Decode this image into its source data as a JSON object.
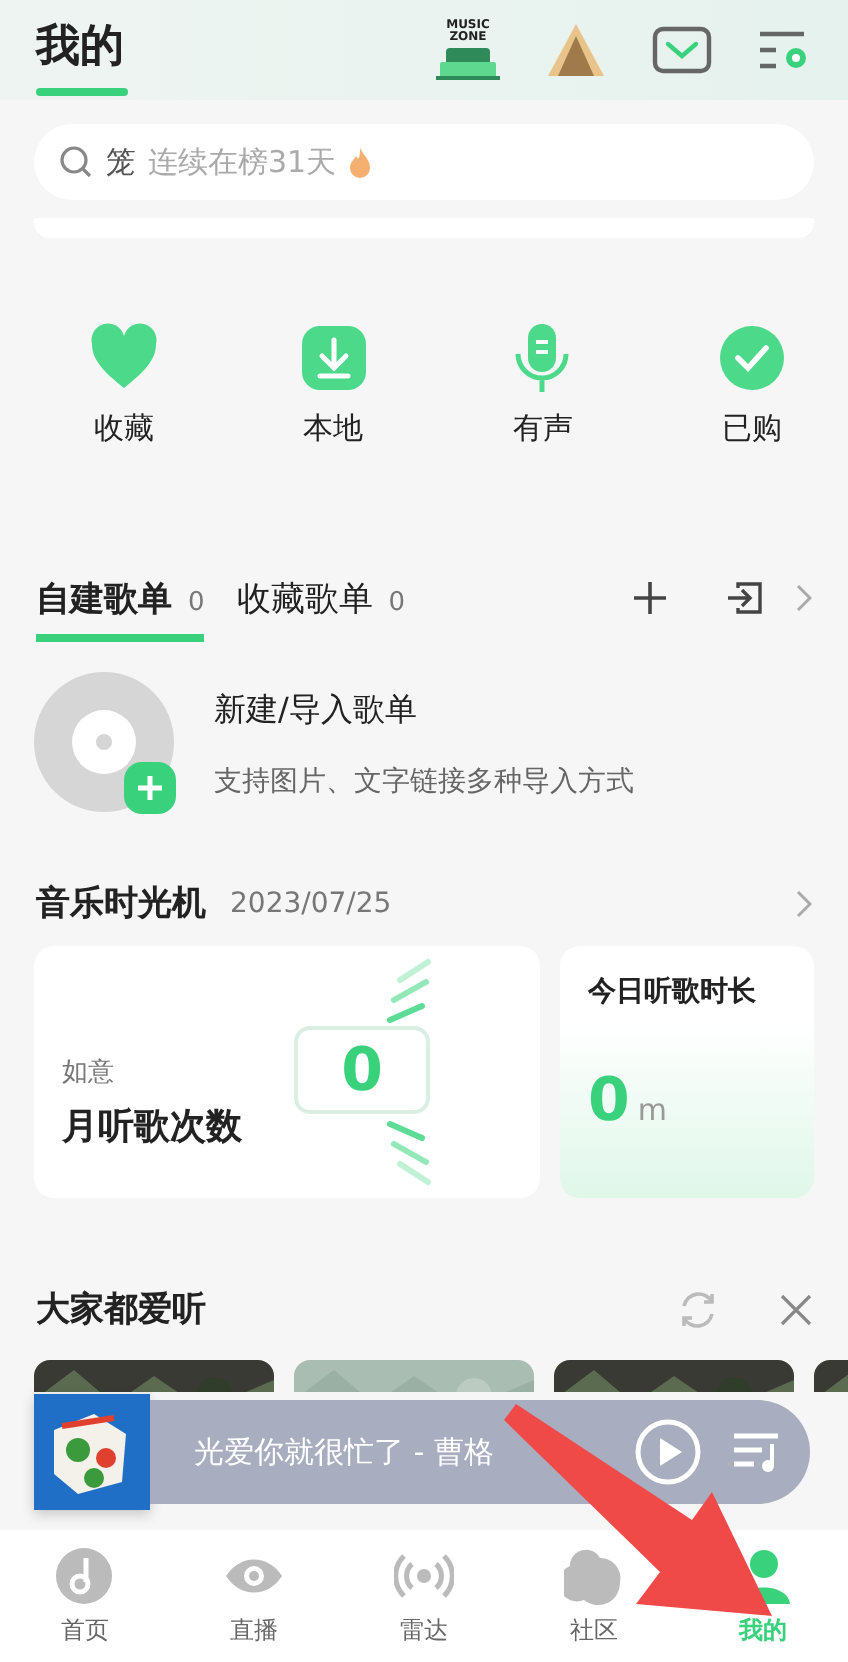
{
  "header": {
    "title": "我的",
    "zone_badge": [
      "MUSIC",
      "ZONE"
    ]
  },
  "search": {
    "prefix": "笼",
    "placeholder": "连续在榜31天"
  },
  "quick_actions": [
    {
      "kind": "heart",
      "label": "收藏"
    },
    {
      "kind": "download",
      "label": "本地"
    },
    {
      "kind": "mic",
      "label": "有声"
    },
    {
      "kind": "check",
      "label": "已购"
    }
  ],
  "playlist_tabs": [
    {
      "label": "自建歌单",
      "count": "0",
      "selected": true
    },
    {
      "label": "收藏歌单",
      "count": "0",
      "selected": false
    }
  ],
  "create_playlist": {
    "title": "新建/导入歌单",
    "subtitle": "支持图片、文字链接多种导入方式"
  },
  "time_machine": {
    "title": "音乐时光机",
    "date": "2023/07/25",
    "month_card": {
      "caption": "如意",
      "label": "月听歌次数",
      "value": "0"
    },
    "today_card": {
      "label": "今日听歌时长",
      "value": "0",
      "unit": "m"
    }
  },
  "popular": {
    "title": "大家都爱听"
  },
  "player": {
    "song": "光爱你就很忙了 - 曹格"
  },
  "bottom_nav": [
    {
      "kind": "home",
      "label": "首页",
      "selected": false
    },
    {
      "kind": "live",
      "label": "直播",
      "selected": false
    },
    {
      "kind": "radar",
      "label": "雷达",
      "selected": false
    },
    {
      "kind": "community",
      "label": "社区",
      "selected": false
    },
    {
      "kind": "me",
      "label": "我的",
      "selected": true
    }
  ]
}
